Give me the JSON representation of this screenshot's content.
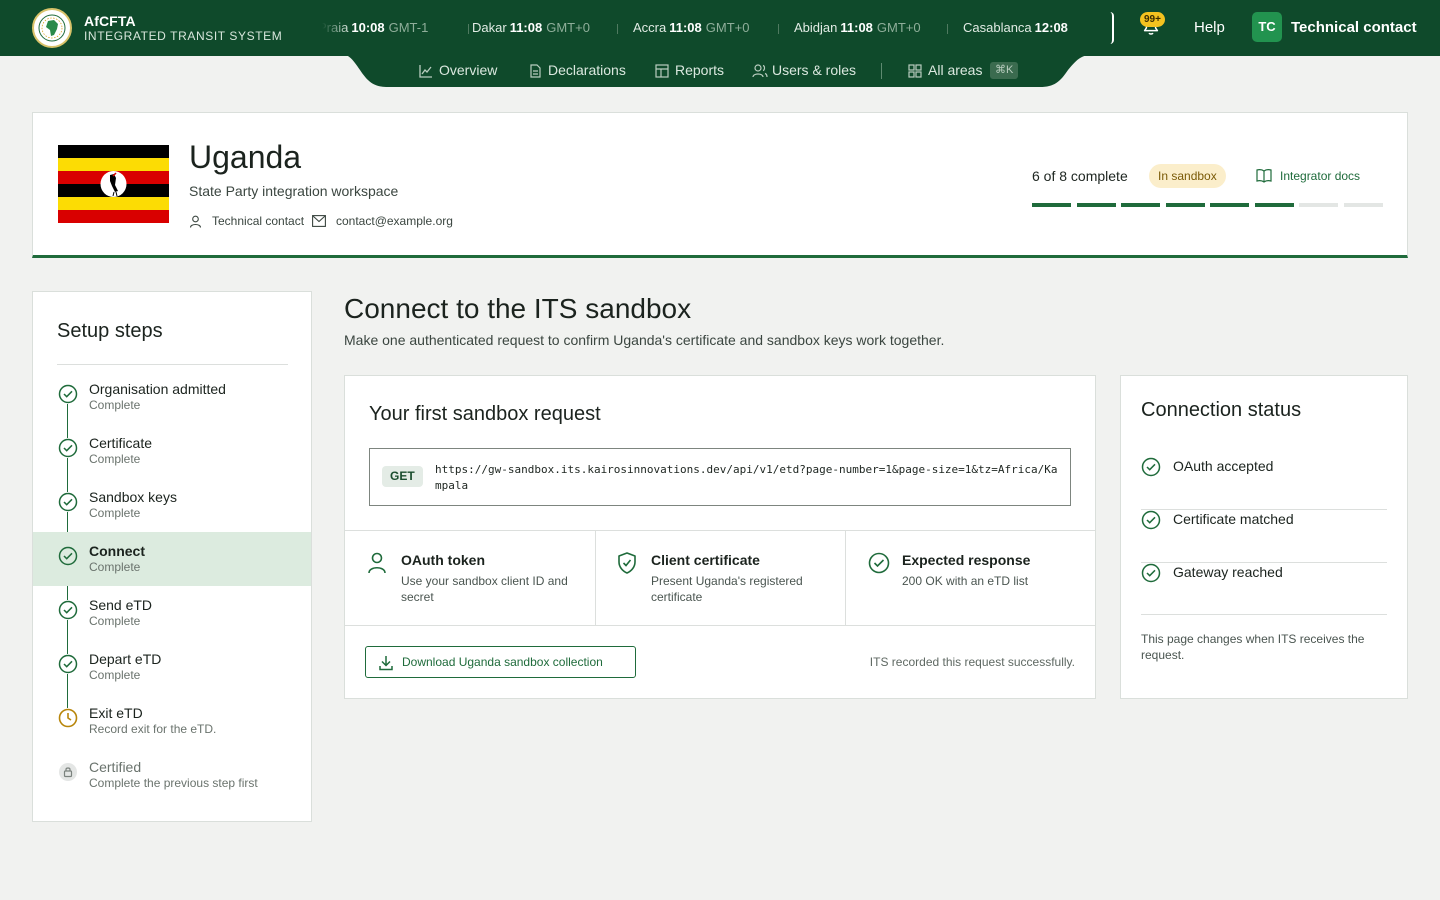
{
  "brand": {
    "name": "AfCFTA",
    "subtitle": "INTEGRATED TRANSIT SYSTEM"
  },
  "clocks": [
    {
      "city": "Praia",
      "time": "10:08",
      "tz": "GMT-1"
    },
    {
      "city": "Dakar",
      "time": "11:08",
      "tz": "GMT+0"
    },
    {
      "city": "Accra",
      "time": "11:08",
      "tz": "GMT+0"
    },
    {
      "city": "Abidjan",
      "time": "11:08",
      "tz": "GMT+0"
    },
    {
      "city": "Casablanca",
      "time": "12:08",
      "tz": ""
    }
  ],
  "header_actions": {
    "notifications_badge": "99+",
    "help_label": "Help",
    "user_initials": "TC",
    "user_name": "Technical contact"
  },
  "nav": {
    "items": [
      {
        "label": "Overview",
        "icon": "chart-line-icon"
      },
      {
        "label": "Declarations",
        "icon": "document-icon"
      },
      {
        "label": "Reports",
        "icon": "table-icon"
      },
      {
        "label": "Users & roles",
        "icon": "users-icon"
      }
    ],
    "all_areas": {
      "label": "All areas",
      "icon": "grid-icon",
      "shortcut": "⌘K"
    }
  },
  "country": {
    "name": "Uganda",
    "subtitle": "State Party integration workspace",
    "contact_role": "Technical contact",
    "contact_email": "contact@example.org",
    "progress_text": "6 of 8 complete",
    "progress_done": 6,
    "progress_total": 8,
    "status_badge": "In sandbox",
    "docs_link": "Integrator docs"
  },
  "steps": {
    "title": "Setup steps",
    "items": [
      {
        "label": "Organisation admitted",
        "sub": "Complete",
        "state": "complete"
      },
      {
        "label": "Certificate",
        "sub": "Complete",
        "state": "complete"
      },
      {
        "label": "Sandbox keys",
        "sub": "Complete",
        "state": "complete"
      },
      {
        "label": "Connect",
        "sub": "Complete",
        "state": "active"
      },
      {
        "label": "Send eTD",
        "sub": "Complete",
        "state": "complete"
      },
      {
        "label": "Depart eTD",
        "sub": "Complete",
        "state": "complete"
      },
      {
        "label": "Exit eTD",
        "sub": "Record exit for the eTD.",
        "state": "pending"
      },
      {
        "label": "Certified",
        "sub": "Complete the previous step first",
        "state": "locked"
      }
    ]
  },
  "main": {
    "title": "Connect to the ITS sandbox",
    "subtitle": "Make one authenticated request to confirm Uganda's certificate and sandbox keys work together.",
    "request": {
      "title": "Your first sandbox request",
      "method": "GET",
      "url": "https://gw-sandbox.its.kairosinnovations.dev/api/v1/etd?page-number=1&page-size=1&tz=Africa/Kampala"
    },
    "features": [
      {
        "title": "OAuth token",
        "desc": "Use your sandbox client ID and secret",
        "icon": "user-icon"
      },
      {
        "title": "Client certificate",
        "desc": "Present Uganda's registered certificate",
        "icon": "shield-check-icon"
      },
      {
        "title": "Expected response",
        "desc": "200 OK with an eTD list",
        "icon": "check-circle-icon"
      }
    ],
    "download_button": "Download Uganda sandbox collection",
    "recorded_text": "ITS recorded this request successfully."
  },
  "connection": {
    "title": "Connection status",
    "items": [
      {
        "label": "OAuth accepted"
      },
      {
        "label": "Certificate matched"
      },
      {
        "label": "Gateway reached"
      }
    ],
    "note": "This page changes when ITS receives the request."
  },
  "colors": {
    "brand_green": "#0f4a2b",
    "accent_green": "#1f6b3b",
    "sandbox_badge_bg": "#fbeecb",
    "pending_amber": "#b8860b",
    "notification_yellow": "#f4c21f"
  }
}
